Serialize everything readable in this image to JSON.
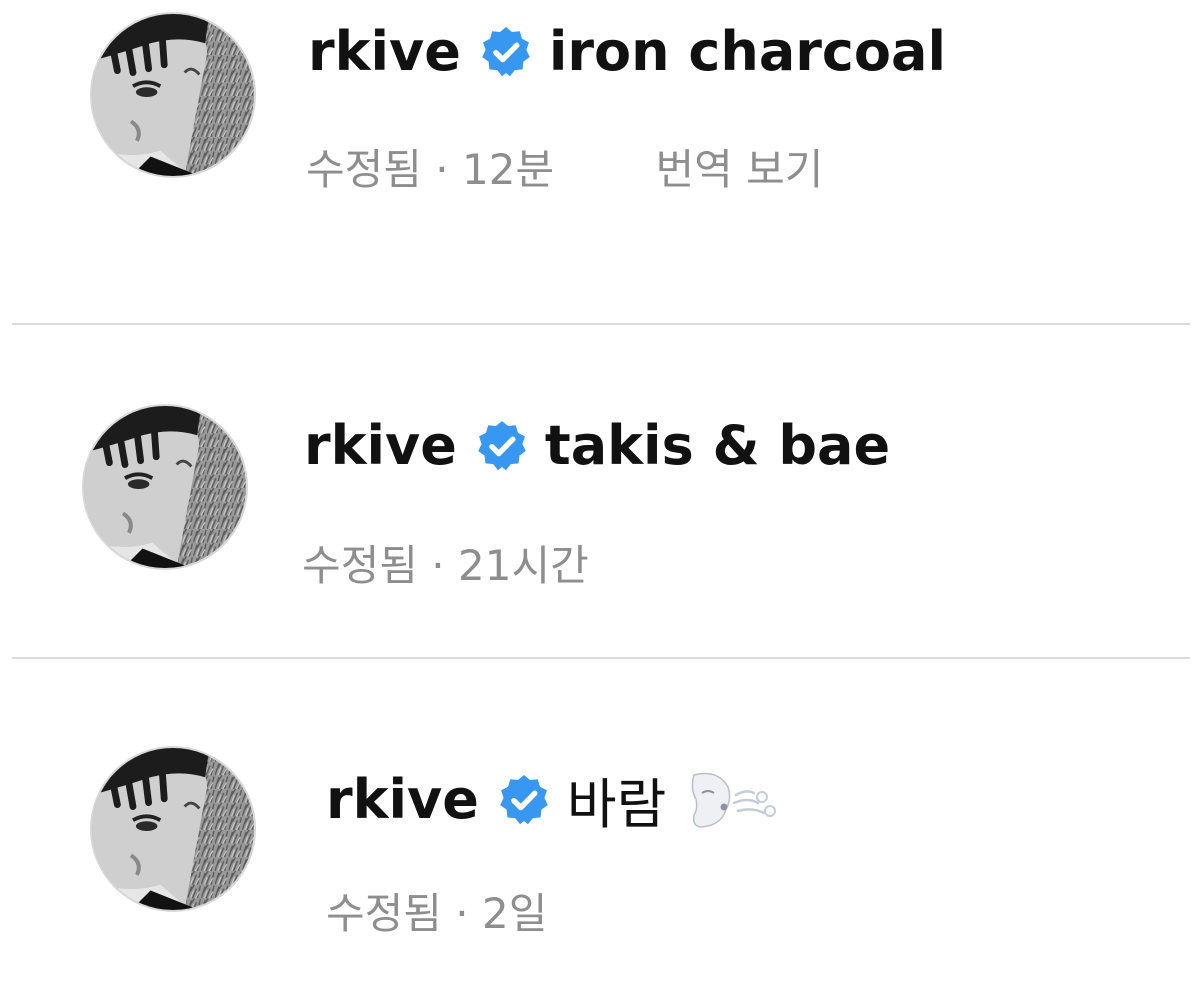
{
  "comments": [
    {
      "username": "rkive",
      "text": "iron charcoal",
      "edited_label": "수정됨",
      "separator": "·",
      "time": "12분",
      "translate_label": "번역 보기",
      "badge_icon": "verified-badge-icon"
    },
    {
      "username": "rkive",
      "text": "takis & bae",
      "edited_label": "수정됨",
      "separator": "·",
      "time": "21시간",
      "badge_icon": "verified-badge-icon"
    },
    {
      "username": "rkive",
      "text": "바람",
      "edited_label": "수정됨",
      "separator": "·",
      "time": "2일",
      "badge_icon": "verified-badge-icon",
      "emoji_icon": "wind-face-emoji"
    }
  ],
  "colors": {
    "badge": "#3897f0",
    "meta_text": "#8e8e8e",
    "divider": "#dbdbdb"
  }
}
